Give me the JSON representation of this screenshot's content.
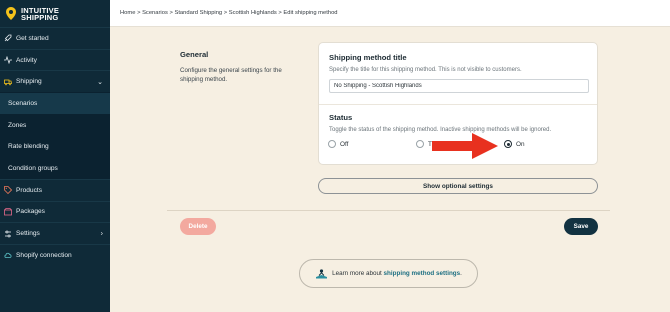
{
  "app": {
    "logo_line1": "INTUITIVE",
    "logo_line2": "SHIPPING"
  },
  "breadcrumb": "Home > Scenarios > Standard Shipping > Scottish Highlands > Edit shipping method",
  "sidebar": {
    "items": [
      {
        "label": "Get started",
        "icon": "rocket-icon"
      },
      {
        "label": "Activity",
        "icon": "activity-icon"
      },
      {
        "label": "Shipping",
        "icon": "truck-icon",
        "expanded": true
      },
      {
        "label": "Scenarios",
        "sub": true,
        "active": true
      },
      {
        "label": "Zones",
        "sub": true
      },
      {
        "label": "Rate blending",
        "sub": true
      },
      {
        "label": "Condition groups",
        "sub": true
      },
      {
        "label": "Products",
        "icon": "tag-icon"
      },
      {
        "label": "Packages",
        "icon": "package-icon"
      },
      {
        "label": "Settings",
        "icon": "settings-icon"
      },
      {
        "label": "Shopify connection",
        "icon": "cloud-icon"
      }
    ]
  },
  "general": {
    "title": "General",
    "description": "Configure the general settings for the shipping method."
  },
  "method_title": {
    "label": "Shipping method title",
    "hint": "Specify the title for this shipping method. This is not visible to customers.",
    "value": "No Shipping - Scottish Highlands"
  },
  "status": {
    "label": "Status",
    "hint": "Toggle the status of the shipping method. Inactive shipping methods will be ignored.",
    "options": [
      "Off",
      "T",
      "On"
    ],
    "selected": "On"
  },
  "buttons": {
    "optional": "Show optional settings",
    "delete": "Delete",
    "save": "Save"
  },
  "learn": {
    "prefix": "Learn more about",
    "link": "shipping method settings",
    "suffix": "."
  },
  "colors": {
    "sidebar_bg": "#0f2a38",
    "page_bg": "#f6efe2",
    "delete": "#f3a99f",
    "save": "#123241",
    "arrow": "#e8311f",
    "logo_pin": "#f4c21b"
  }
}
